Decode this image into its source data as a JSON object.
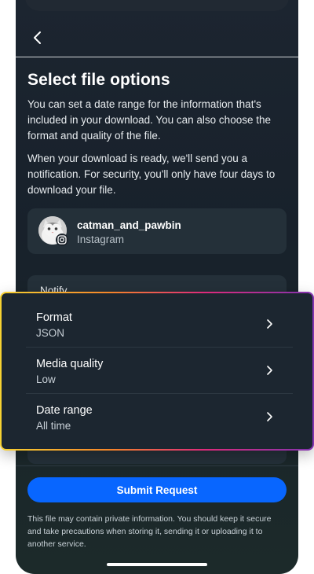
{
  "header": {
    "back_icon": "chevron-left-icon"
  },
  "page": {
    "title": "Select file options",
    "para1": "You can set a date range for the information that's included in your download. You can also choose the format and quality of the file.",
    "para2": "When your download is ready, we'll send you a notification. For security, you'll only have four days to download your file."
  },
  "account": {
    "username": "catman_and_pawbin",
    "platform": "Instagram",
    "badge_icon": "instagram-icon"
  },
  "notify": {
    "label": "Notify"
  },
  "options": [
    {
      "label": "Format",
      "value": "JSON"
    },
    {
      "label": "Media quality",
      "value": "Low"
    },
    {
      "label": "Date range",
      "value": "All time"
    }
  ],
  "submit": {
    "label": "Submit Request",
    "color": "#0866ff"
  },
  "disclaimer": "This file may contain private information. You should keep it secure and take precautions when storing it, sending it or uploading it to another service."
}
